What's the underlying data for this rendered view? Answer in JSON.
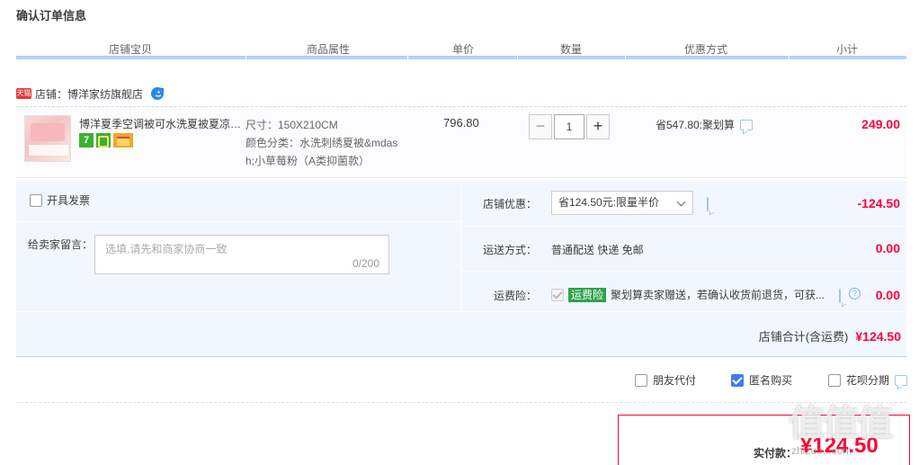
{
  "page": {
    "title": "确认订单信息"
  },
  "columns": [
    "店铺宝贝",
    "商品属性",
    "单价",
    "数量",
    "优惠方式",
    "小计"
  ],
  "shop": {
    "badge": "天猫",
    "label": "店铺：博洋家纺旗舰店"
  },
  "item": {
    "title": "博洋夏季空调被可水洗夏被夏凉被...",
    "service_badge_text": "7",
    "attrs": {
      "size": "尺寸：150X210CM",
      "color_line1": "颜色分类：水洗刺绣夏被&mdas",
      "color_line2": "h;小草莓粉（A类抑菌款）"
    },
    "unit_price": "796.80",
    "quantity": "1",
    "qty_minus": "−",
    "qty_plus": "+",
    "promo": "省547.80:聚划算",
    "subtotal": "249.00"
  },
  "invoice": {
    "label": "开具发票",
    "checked": false
  },
  "message": {
    "label": "给卖家留言：",
    "placeholder": "选填,请先和商家协商一致",
    "counter": "0/200"
  },
  "shop_discount": {
    "label": "店铺优惠：",
    "selected": "省124.50元:限量半价",
    "amount": "-124.50"
  },
  "shipping": {
    "label": "运送方式：",
    "value": "普通配送 快递 免邮",
    "amount": "0.00"
  },
  "insurance": {
    "label": "运费险：",
    "tag": "运费险",
    "text": "聚划算卖家赠送，若确认收货前退货，可获...",
    "help": "?",
    "amount": "0.00"
  },
  "shop_total": {
    "label": "店铺合计(含运费)",
    "amount": "¥124.50"
  },
  "options": [
    {
      "label": "朋友代付",
      "checked": false
    },
    {
      "label": "匿名购买",
      "checked": true
    },
    {
      "label": "花呗分期",
      "checked": false
    }
  ],
  "payment": {
    "label": "实付款：",
    "amount": "¥124.50"
  },
  "watermark": {
    "glyphs": "值值值",
    "url": "zhizuo...com"
  }
}
